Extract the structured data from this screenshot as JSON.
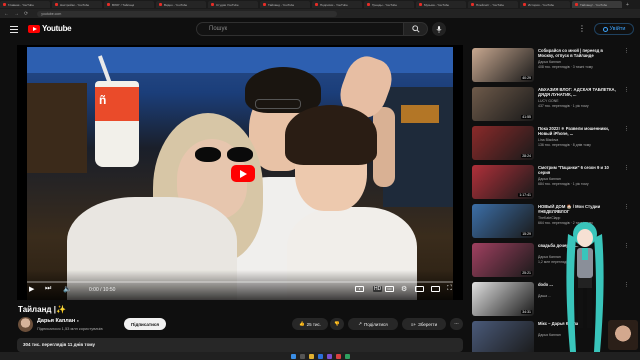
{
  "browser": {
    "tabs": [
      {
        "label": "Главная - YouTube",
        "active": false
      },
      {
        "label": "Настройки - YouTube",
        "active": false
      },
      {
        "label": "ВЛОГ / Тайланд",
        "active": false
      },
      {
        "label": "Видео - YouTube",
        "active": false
      },
      {
        "label": "Студия YouTube",
        "active": false
      },
      {
        "label": "Тайланд - YouTube",
        "active": false
      },
      {
        "label": "Подписки - YouTube",
        "active": false
      },
      {
        "label": "Тренды - YouTube",
        "active": false
      },
      {
        "label": "Музыка - YouTube",
        "active": false
      },
      {
        "label": "Плейлист - YouTube",
        "active": false
      },
      {
        "label": "История - YouTube",
        "active": false
      },
      {
        "label": "Тайланд! - YouTube",
        "active": true
      }
    ],
    "url": "youtube.com"
  },
  "header": {
    "logo_text": "Youtube",
    "search_placeholder": "Пошук",
    "signin_label": "Увійти"
  },
  "player": {
    "cup_text": "n\nuu",
    "time": "0:00 / 10:50",
    "progress": 0.0
  },
  "video": {
    "title": "Тайланд |✨",
    "channel": "Дарья Каплан",
    "subscribers": "Підписалося 1,53 млн користувачів",
    "subscribe_label": "Підписатися",
    "likes": "25 тис.",
    "share_label": "Поділитися",
    "save_label": "Зберегти",
    "description": "304 тис. переглядів  11 днів тому"
  },
  "sidebar": {
    "items": [
      {
        "title": "Собирайся со мной | переезд в Москву, отпуск в Тайланде",
        "channel": "Дарья Каплан",
        "meta": "408 тис. переглядів · 3 тижні тому",
        "duration": "40:29",
        "color": "#c8a890"
      },
      {
        "title": "АБХАЗИЯ ВЛОГ: АДСКАЯ ТАБЛЕТКА, ДЯДЯ ЛУНАТИК, ...",
        "channel": "LUCY GONE",
        "meta": "437 тис. переглядів · 1 рік тому",
        "duration": "41:55",
        "color": "#6e5a4a"
      },
      {
        "title": "Пока 2022! ❄ Развели мошенники, Новый iPhone, ...",
        "channel": "Lina Bladova",
        "meta": "136 тис. переглядів · 8 днів тому",
        "duration": "28:24",
        "color": "#8b2a2a"
      },
      {
        "title": "Смотрим \"Пацанки\" 6 сезон 9 и 10 серия",
        "channel": "Дарья Каплан",
        "meta": "684 тис. переглядів · 1 рік тому",
        "duration": "1:17:41",
        "color": "#b0303a"
      },
      {
        "title": "НОВЫЙ ДОМ 🏠 / Мои Студии #НЕДЕЛЯВЛОГ",
        "channel": "TheKateClapp",
        "meta": "664 тис. переглядів · 2 тижні тому",
        "duration": "15:29",
        "color": "#3c6fa8"
      },
      {
        "title": "свадьба дочерей ...",
        "channel": "Дарья Каплан",
        "meta": "1,2 млн переглядів",
        "duration": "25:21",
        "color": "#a04060"
      },
      {
        "title": "dodo ...",
        "channel": "Даша ...",
        "meta": "",
        "duration": "34:31",
        "color": "#e0e0e0"
      },
      {
        "title": "Мікс – Дарья Каплан",
        "channel": "Дарья Каплан",
        "meta": "",
        "duration": "",
        "color": "#4a5a7a"
      }
    ]
  },
  "colors": {
    "accent": "#ff0000",
    "link": "#3ea6ff",
    "background": "#0f0f0f"
  },
  "icons": [
    "menu-icon",
    "search-icon",
    "mic-icon",
    "more-icon",
    "user-icon",
    "play-icon",
    "next-icon",
    "volume-icon",
    "cc-icon",
    "settings-icon",
    "miniplayer-icon",
    "theater-icon",
    "fullscreen-icon",
    "like-icon",
    "dislike-icon",
    "share-icon",
    "save-icon",
    "verified-icon"
  ]
}
